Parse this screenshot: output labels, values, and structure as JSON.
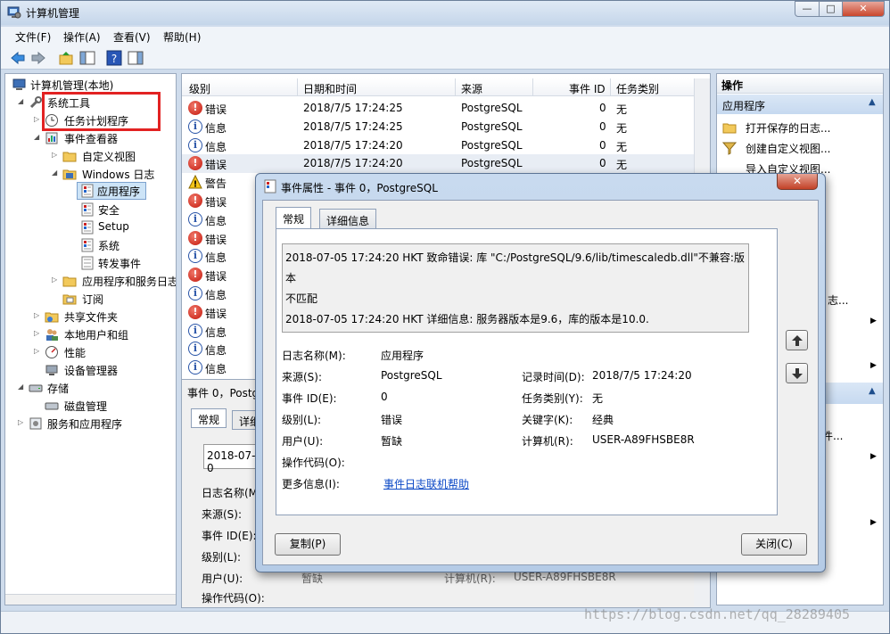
{
  "window": {
    "title": "计算机管理",
    "btn_min": "—",
    "btn_max": "□",
    "btn_close": "✕"
  },
  "menu": [
    "文件(F)",
    "操作(A)",
    "查看(V)",
    "帮助(H)"
  ],
  "tree": {
    "root": "计算机管理(本地)",
    "system_tools": "系统工具",
    "task_scheduler": "任务计划程序",
    "event_viewer": "事件查看器",
    "custom_views": "自定义视图",
    "windows_logs": "Windows 日志",
    "application": "应用程序",
    "security": "安全",
    "setup": "Setup",
    "system": "系统",
    "forwarded": "转发事件",
    "app_service_logs": "应用程序和服务日志",
    "subscriptions": "订阅",
    "shared_folders": "共享文件夹",
    "local_users": "本地用户和组",
    "performance": "性能",
    "device_manager": "设备管理器",
    "storage": "存储",
    "disk_mgmt": "磁盘管理",
    "services_apps": "服务和应用程序"
  },
  "events": {
    "headers": [
      "级别",
      "日期和时间",
      "来源",
      "事件 ID",
      "任务类别"
    ],
    "rows": [
      {
        "level": "错误",
        "type": "err",
        "time": "2018/7/5 17:24:25",
        "source": "PostgreSQL",
        "id": "0",
        "task": "无"
      },
      {
        "level": "信息",
        "type": "inf",
        "time": "2018/7/5 17:24:25",
        "source": "PostgreSQL",
        "id": "0",
        "task": "无"
      },
      {
        "level": "信息",
        "type": "inf",
        "time": "2018/7/5 17:24:20",
        "source": "PostgreSQL",
        "id": "0",
        "task": "无"
      },
      {
        "level": "错误",
        "type": "err",
        "time": "2018/7/5 17:24:20",
        "source": "PostgreSQL",
        "id": "0",
        "task": "无"
      },
      {
        "level": "警告",
        "type": "warn",
        "time": "",
        "source": "",
        "id": "",
        "task": ""
      },
      {
        "level": "错误",
        "type": "err",
        "time": "",
        "source": "",
        "id": "",
        "task": ""
      },
      {
        "level": "信息",
        "type": "inf",
        "time": "",
        "source": "",
        "id": "",
        "task": ""
      },
      {
        "level": "错误",
        "type": "err",
        "time": "",
        "source": "",
        "id": "",
        "task": ""
      },
      {
        "level": "信息",
        "type": "inf",
        "time": "",
        "source": "",
        "id": "",
        "task": ""
      },
      {
        "level": "错误",
        "type": "err",
        "time": "",
        "source": "",
        "id": "",
        "task": ""
      },
      {
        "level": "信息",
        "type": "inf",
        "time": "",
        "source": "",
        "id": "",
        "task": ""
      },
      {
        "level": "错误",
        "type": "err",
        "time": "",
        "source": "",
        "id": "",
        "task": ""
      },
      {
        "level": "信息",
        "type": "inf",
        "time": "",
        "source": "",
        "id": "",
        "task": ""
      },
      {
        "level": "信息",
        "type": "inf",
        "time": "",
        "source": "",
        "id": "",
        "task": ""
      },
      {
        "level": "信息",
        "type": "inf",
        "time": "",
        "source": "",
        "id": "",
        "task": ""
      }
    ]
  },
  "detail_pane": {
    "header": "事件 0，Postg",
    "tab_general": "常规",
    "tab_details": "详细",
    "msg_snippet": "2018-07-0",
    "labels": [
      "日志名称(M",
      "来源(S):",
      "事件 ID(E):",
      "级别(L):",
      "用户(U):",
      "操作代码(O):"
    ],
    "user_value": "暂缺",
    "computer_label": "计算机(R):",
    "computer_value": "USER-A89FHSBE8R"
  },
  "actions": {
    "header": "操作",
    "section": "应用程序",
    "items": [
      "打开保存的日志...",
      "创建自定义视图...",
      "导入自定义视图..."
    ],
    "tail1": "日志...",
    "tail2": "件..."
  },
  "dialog": {
    "title": "事件属性 - 事件 0，PostgreSQL",
    "tab_general": "常规",
    "tab_details": "详细信息",
    "message_line1": "2018-07-05 17:24:20 HKT 致命错误:  库 \"C:/PostgreSQL/9.6/lib/timescaledb.dll\"不兼容:版本",
    "message_line2": "不匹配",
    "message_line3": "2018-07-05 17:24:20 HKT 详细信息:  服务器版本是9.6，库的版本是10.0.",
    "fields": {
      "log_name_label": "日志名称(M):",
      "log_name": "应用程序",
      "source_label": "来源(S):",
      "source": "PostgreSQL",
      "logged_label": "记录时间(D):",
      "logged": "2018/7/5 17:24:20",
      "event_id_label": "事件 ID(E):",
      "event_id": "0",
      "task_label": "任务类别(Y):",
      "task": "无",
      "level_label": "级别(L):",
      "level": "错误",
      "keywords_label": "关键字(K):",
      "keywords": "经典",
      "user_label": "用户(U):",
      "user": "暂缺",
      "computer_label": "计算机(R):",
      "computer": "USER-A89FHSBE8R",
      "opcode_label": "操作代码(O):",
      "more_info_label": "更多信息(I):",
      "more_info_link": "事件日志联机帮助"
    },
    "copy_button": "复制(P)",
    "close_button": "关闭(C)"
  },
  "watermark": "https://blog.csdn.net/qq_28289405"
}
